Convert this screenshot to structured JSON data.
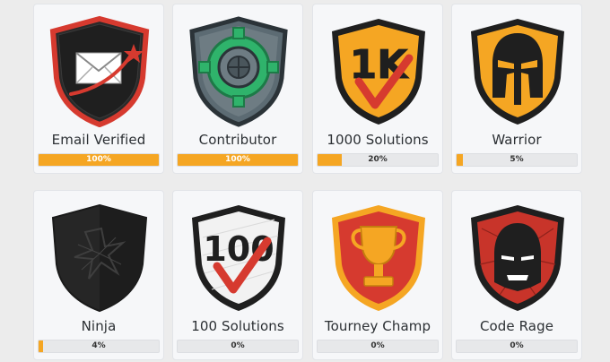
{
  "badges": [
    {
      "name": "Email Verified",
      "progress_label": "100%",
      "progress": 1.0,
      "icon": "email-verified-icon"
    },
    {
      "name": "Contributor",
      "progress_label": "100%",
      "progress": 1.0,
      "icon": "contributor-icon"
    },
    {
      "name": "1000 Solutions",
      "progress_label": "20%",
      "progress": 0.2,
      "icon": "1000-solutions-icon"
    },
    {
      "name": "Warrior",
      "progress_label": "5%",
      "progress": 0.05,
      "icon": "warrior-icon"
    },
    {
      "name": "Ninja",
      "progress_label": "4%",
      "progress": 0.04,
      "icon": "ninja-icon"
    },
    {
      "name": "100 Solutions",
      "progress_label": "0%",
      "progress": 0.0,
      "icon": "100-solutions-icon"
    },
    {
      "name": "Tourney Champ",
      "progress_label": "0%",
      "progress": 0.0,
      "icon": "tourney-champ-icon"
    },
    {
      "name": "Code Rage",
      "progress_label": "0%",
      "progress": 0.0,
      "icon": "code-rage-icon"
    }
  ],
  "icon_text": {
    "thousand": "1K",
    "hundred": "100"
  },
  "colors": {
    "progress_fill": "#f5a623",
    "progress_track": "#e7e8ea",
    "shield_dark": "#1f1f1f",
    "shield_red": "#d63a2f",
    "shield_orange": "#f5a623",
    "shield_green": "#2fb36b"
  }
}
